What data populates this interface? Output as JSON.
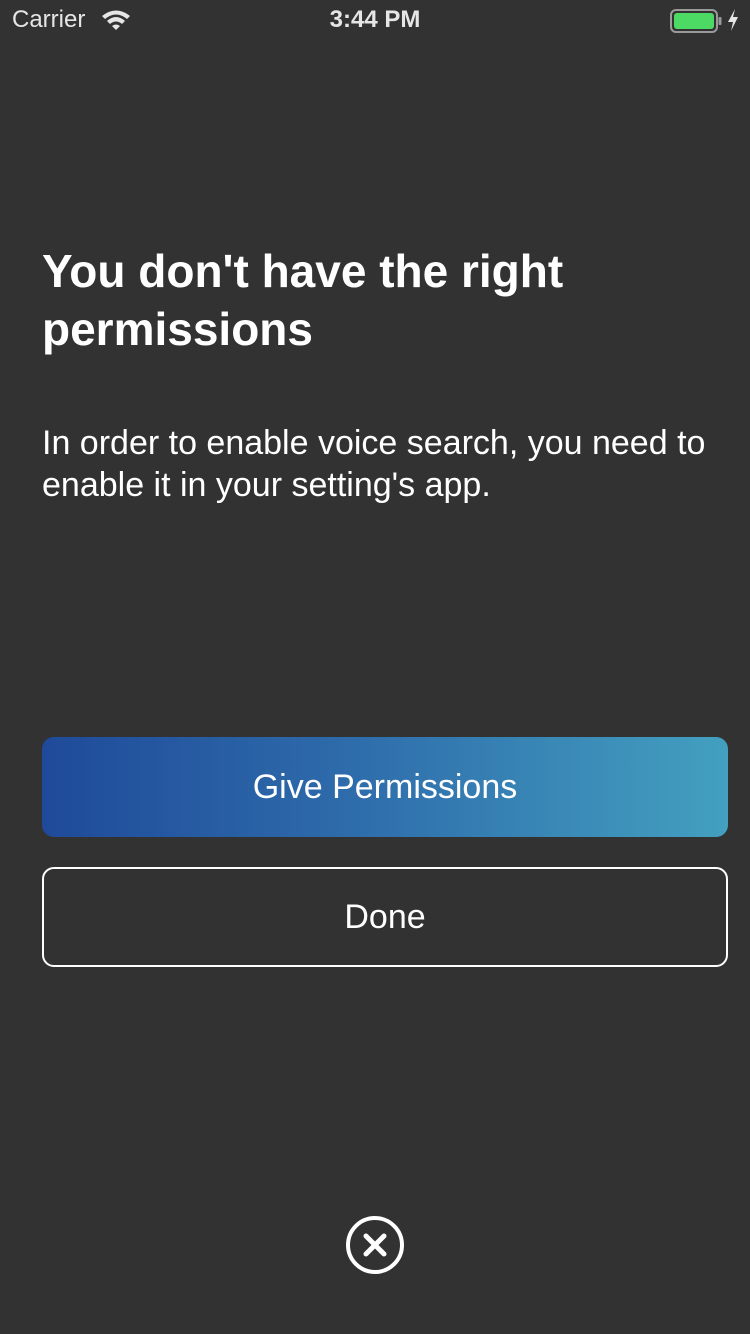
{
  "status_bar": {
    "carrier": "Carrier",
    "time": "3:44 PM",
    "battery_color": "#4cd964"
  },
  "dialog": {
    "title": "You don't have the right permissions",
    "message": "In order to enable voice search, you need to enable it in your setting's app.",
    "primary_button": "Give Permissions",
    "secondary_button": "Done",
    "close_icon": "close-circle-icon"
  },
  "colors": {
    "background": "#323232",
    "gradient_start": "#1f4a99",
    "gradient_end": "#43a0c0",
    "text": "#ffffff"
  }
}
